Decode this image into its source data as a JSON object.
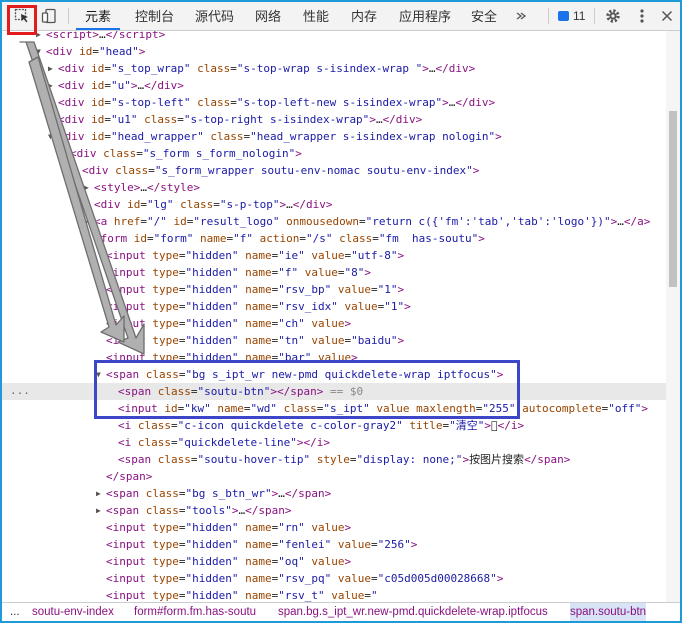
{
  "toolbar": {
    "tabs": [
      "元素",
      "控制台",
      "源代码",
      "网络",
      "性能",
      "内存",
      "应用程序",
      "安全"
    ],
    "active_tab": "元素",
    "issues_count": "11",
    "icons": [
      "inspect-element-icon",
      "device-toolbar-icon",
      "issues-icon",
      "gear-icon",
      "more-options-icon",
      "close-icon"
    ]
  },
  "elements_tree": {
    "lines": [
      {
        "indent": 0,
        "tri": "▶",
        "html": "<span class='t'>&lt;script&gt;</span>…<span class='t'>&lt;/script&gt;</span>"
      },
      {
        "indent": 0,
        "tri": "▼",
        "html": "<span class='t'>&lt;div</span> <span class='a'>id</span>=<span class='v'>\"head\"</span><span class='t'>&gt;</span>"
      },
      {
        "indent": 1,
        "tri": "▶",
        "html": "<span class='t'>&lt;div</span> <span class='a'>id</span>=<span class='v'>\"s_top_wrap\"</span> <span class='a'>class</span>=<span class='v'>\"s-top-wrap s-isindex-wrap \"</span><span class='t'>&gt;</span>…<span class='t'>&lt;/div&gt;</span>"
      },
      {
        "indent": 1,
        "tri": "▶",
        "html": "<span class='t'>&lt;div</span> <span class='a'>id</span>=<span class='v'>\"u\"</span><span class='t'>&gt;</span>…<span class='t'>&lt;/div&gt;</span>"
      },
      {
        "indent": 1,
        "tri": "▶",
        "html": "<span class='t'>&lt;div</span> <span class='a'>id</span>=<span class='v'>\"s-top-left\"</span> <span class='a'>class</span>=<span class='v'>\"s-top-left-new s-isindex-wrap\"</span><span class='t'>&gt;</span>…<span class='t'>&lt;/div&gt;</span>"
      },
      {
        "indent": 1,
        "tri": "▶",
        "html": "<span class='t'>&lt;div</span> <span class='a'>id</span>=<span class='v'>\"u1\"</span> <span class='a'>class</span>=<span class='v'>\"s-top-right s-isindex-wrap\"</span><span class='t'>&gt;</span>…<span class='t'>&lt;/div&gt;</span>"
      },
      {
        "indent": 1,
        "tri": "▼",
        "html": "<span class='t'>&lt;div</span> <span class='a'>id</span>=<span class='v'>\"head_wrapper\"</span> <span class='a'>class</span>=<span class='v'>\"head_wrapper s-isindex-wrap nologin\"</span><span class='t'>&gt;</span>"
      },
      {
        "indent": 2,
        "tri": "▼",
        "html": "<span class='t'>&lt;div</span> <span class='a'>class</span>=<span class='v'>\"s_form s_form_nologin\"</span><span class='t'>&gt;</span>"
      },
      {
        "indent": 3,
        "tri": "▼",
        "html": "<span class='t'>&lt;div</span> <span class='a'>class</span>=<span class='v'>\"s_form_wrapper soutu-env-nomac soutu-env-index\"</span><span class='t'>&gt;</span>"
      },
      {
        "indent": 4,
        "tri": "▶",
        "html": "<span class='t'>&lt;style&gt;</span>…<span class='t'>&lt;/style&gt;</span>"
      },
      {
        "indent": 4,
        "tri": "▶",
        "html": "<span class='t'>&lt;div</span> <span class='a'>id</span>=<span class='v'>\"lg\"</span> <span class='a'>class</span>=<span class='v'>\"s-p-top\"</span><span class='t'>&gt;</span>…<span class='t'>&lt;/div&gt;</span>"
      },
      {
        "indent": 4,
        "tri": "▶",
        "html": "<span class='t'>&lt;a</span> <span class='a'>href</span>=<span class='v'>\"/\"</span> <span class='a'>id</span>=<span class='v'>\"result_logo\"</span> <span class='a'>onmousedown</span>=<span class='v'>\"return c({'fm':'tab','tab':'logo'})\"</span><span class='t'>&gt;</span>…<span class='t'>&lt;/a&gt;</span>"
      },
      {
        "indent": 4,
        "tri": "▼",
        "html": "<span class='t'>&lt;form</span> <span class='a'>id</span>=<span class='v'>\"form\"</span> <span class='a'>name</span>=<span class='v'>\"f\"</span> <span class='a'>action</span>=<span class='v'>\"/s\"</span> <span class='a'>class</span>=<span class='v'>\"fm  has-soutu\"</span><span class='t'>&gt;</span>"
      },
      {
        "indent": 5,
        "tri": "",
        "html": "<span class='t'>&lt;input</span> <span class='a'>type</span>=<span class='v'>\"hidden\"</span> <span class='a'>name</span>=<span class='v'>\"ie\"</span> <span class='a'>value</span>=<span class='v'>\"utf-8\"</span><span class='t'>&gt;</span>"
      },
      {
        "indent": 5,
        "tri": "",
        "html": "<span class='t'>&lt;input</span> <span class='a'>type</span>=<span class='v'>\"hidden\"</span> <span class='a'>name</span>=<span class='v'>\"f\"</span> <span class='a'>value</span>=<span class='v'>\"8\"</span><span class='t'>&gt;</span>"
      },
      {
        "indent": 5,
        "tri": "",
        "html": "<span class='t'>&lt;input</span> <span class='a'>type</span>=<span class='v'>\"hidden\"</span> <span class='a'>name</span>=<span class='v'>\"rsv_bp\"</span> <span class='a'>value</span>=<span class='v'>\"1\"</span><span class='t'>&gt;</span>"
      },
      {
        "indent": 5,
        "tri": "",
        "html": "<span class='t'>&lt;input</span> <span class='a'>type</span>=<span class='v'>\"hidden\"</span> <span class='a'>name</span>=<span class='v'>\"rsv_idx\"</span> <span class='a'>value</span>=<span class='v'>\"1\"</span><span class='t'>&gt;</span>"
      },
      {
        "indent": 5,
        "tri": "",
        "html": "<span class='t'>&lt;input</span> <span class='a'>type</span>=<span class='v'>\"hidden\"</span> <span class='a'>name</span>=<span class='v'>\"ch\"</span> <span class='a'>value</span><span class='t'>&gt;</span>"
      },
      {
        "indent": 5,
        "tri": "",
        "html": "<span class='t'>&lt;input</span> <span class='a'>type</span>=<span class='v'>\"hidden\"</span> <span class='a'>name</span>=<span class='v'>\"tn\"</span> <span class='a'>value</span>=<span class='v'>\"baidu\"</span><span class='t'>&gt;</span>"
      },
      {
        "indent": 5,
        "tri": "",
        "html": "<span class='t'>&lt;input</span> <span class='a'>type</span>=<span class='v'>\"hidden\"</span> <span class='a'>name</span>=<span class='v'>\"bar\"</span> <span class='a'>value</span><span class='t'>&gt;</span>"
      },
      {
        "indent": 5,
        "tri": "▼",
        "html": "<span class='t'>&lt;span</span> <span class='a'>class</span>=<span class='v'>\"bg s_ipt_wr new-pmd quickdelete-wrap iptfocus\"</span><span class='t'>&gt;</span>"
      },
      {
        "indent": 6,
        "tri": "",
        "sel": true,
        "html": "<span class='t'>&lt;span</span> <span class='a'>class</span>=<span class='v'>\"soutu-btn\"</span><span class='t'>&gt;&lt;/span&gt;</span> <span class='dim'>== $0</span>"
      },
      {
        "indent": 6,
        "tri": "",
        "html": "<span class='t'>&lt;input</span> <span class='a'>id</span>=<span class='v'>\"kw\"</span> <span class='a'>name</span>=<span class='v'>\"wd\"</span> <span class='a'>class</span>=<span class='v'>\"s_ipt\"</span> <span class='a'>value</span> <span class='a'>maxlength</span>=<span class='v'>\"255\"</span> <span class='a'>autocomplete</span>=<span class='v'>\"off\"</span><span class='t'>&gt;</span>"
      },
      {
        "indent": 6,
        "tri": "",
        "html": "<span class='t'>&lt;i</span> <span class='a'>class</span>=<span class='v'>\"c-icon quickdelete c-color-gray2\"</span> <span class='a'>title</span>=<span class='v'>\"清空\"</span><span class='t'>&gt;</span><span class='c'>&#xe64f;</span><span class='t'>&lt;/i&gt;</span>"
      },
      {
        "indent": 6,
        "tri": "",
        "html": "<span class='t'>&lt;i</span> <span class='a'>class</span>=<span class='v'>\"quickdelete-line\"</span><span class='t'>&gt;&lt;/i&gt;</span>"
      },
      {
        "indent": 6,
        "tri": "",
        "html": "<span class='t'>&lt;span</span> <span class='a'>class</span>=<span class='v'>\"soutu-hover-tip\"</span> <span class='a'>style</span>=<span class='v'>\"display: none;\"</span><span class='t'>&gt;</span><span class='c'>按图片搜索</span><span class='t'>&lt;/span&gt;</span>"
      },
      {
        "indent": 5,
        "tri": "",
        "html": "<span class='t'>&lt;/span&gt;</span>"
      },
      {
        "indent": 5,
        "tri": "▶",
        "html": "<span class='t'>&lt;span</span> <span class='a'>class</span>=<span class='v'>\"bg s_btn_wr\"</span><span class='t'>&gt;</span>…<span class='t'>&lt;/span&gt;</span>"
      },
      {
        "indent": 5,
        "tri": "▶",
        "html": "<span class='t'>&lt;span</span> <span class='a'>class</span>=<span class='v'>\"tools\"</span><span class='t'>&gt;</span>…<span class='t'>&lt;/span&gt;</span>"
      },
      {
        "indent": 5,
        "tri": "",
        "html": "<span class='t'>&lt;input</span> <span class='a'>type</span>=<span class='v'>\"hidden\"</span> <span class='a'>name</span>=<span class='v'>\"rn\"</span> <span class='a'>value</span><span class='t'>&gt;</span>"
      },
      {
        "indent": 5,
        "tri": "",
        "html": "<span class='t'>&lt;input</span> <span class='a'>type</span>=<span class='v'>\"hidden\"</span> <span class='a'>name</span>=<span class='v'>\"fenlei\"</span> <span class='a'>value</span>=<span class='v'>\"256\"</span><span class='t'>&gt;</span>"
      },
      {
        "indent": 5,
        "tri": "",
        "html": "<span class='t'>&lt;input</span> <span class='a'>type</span>=<span class='v'>\"hidden\"</span> <span class='a'>name</span>=<span class='v'>\"oq\"</span> <span class='a'>value</span><span class='t'>&gt;</span>"
      },
      {
        "indent": 5,
        "tri": "",
        "html": "<span class='t'>&lt;input</span> <span class='a'>type</span>=<span class='v'>\"hidden\"</span> <span class='a'>name</span>=<span class='v'>\"rsv_pq\"</span> <span class='a'>value</span>=<span class='v'>\"c05d005d00028668\"</span><span class='t'>&gt;</span>"
      },
      {
        "indent": 5,
        "tri": "",
        "html": "<span class='t'>&lt;input</span> <span class='a'>type</span>=<span class='v'>\"hidden\"</span> <span class='a'>name</span>=<span class='v'>\"rsv_t\"</span> <span class='a'>value</span>=<span class='v'>\"</span>"
      }
    ]
  },
  "breadcrumb": {
    "ellipsis": "...",
    "items": [
      "soutu-env-index",
      "form#form.fm.has-soutu",
      "span.bg.s_ipt_wr.new-pmd.quickdelete-wrap.iptfocus",
      "span.soutu-btn"
    ]
  },
  "gutter_dots": "..."
}
